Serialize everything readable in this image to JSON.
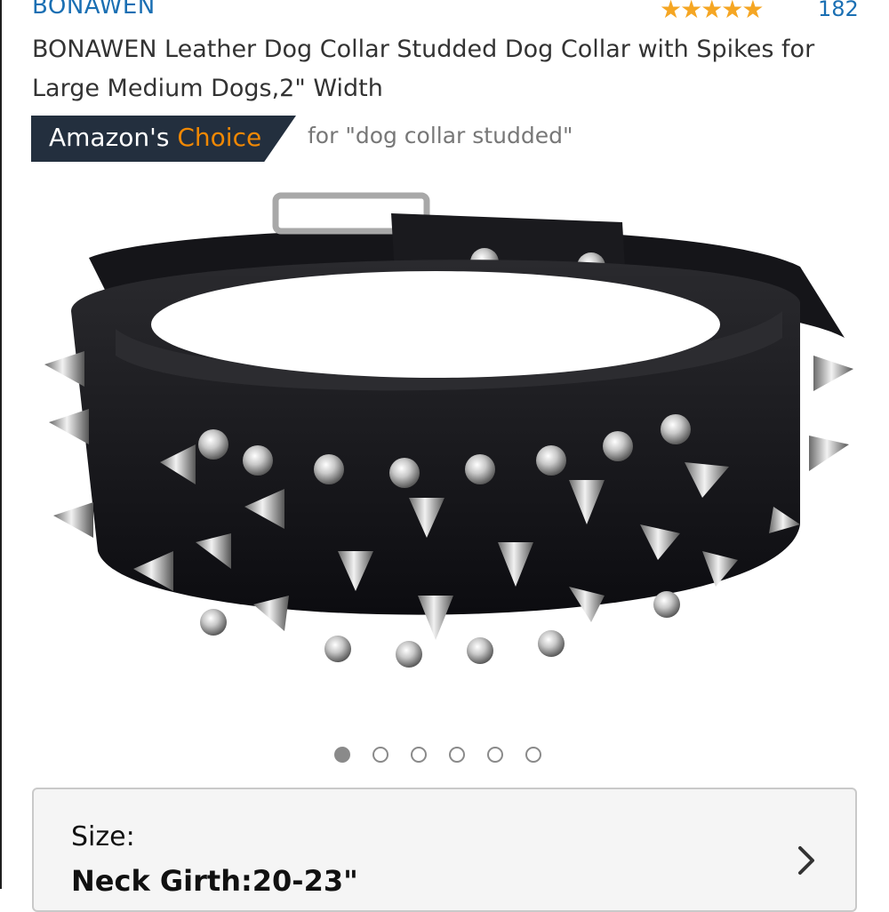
{
  "header": {
    "brand": "BONAWEN",
    "stars": "★★★★★",
    "rating_count": "182",
    "title": "BONAWEN Leather Dog Collar Studded Dog Collar with Spikes for Large Medium Dogs,2\" Width"
  },
  "badge": {
    "label_main": "Amazon's ",
    "label_highlight": "Choice",
    "query_text": "for \"dog collar studded\""
  },
  "gallery": {
    "image_name": "black studded spiked leather dog collar",
    "dot_count": 6,
    "active_index": 0
  },
  "size_selector": {
    "label": "Size:",
    "value": "Neck Girth:20-23\"",
    "icon": "chevron-right-icon"
  },
  "colors": {
    "link_blue": "#1a6fb3",
    "badge_bg": "#232f3e",
    "badge_highlight": "#f08804",
    "star": "#f5a623"
  }
}
